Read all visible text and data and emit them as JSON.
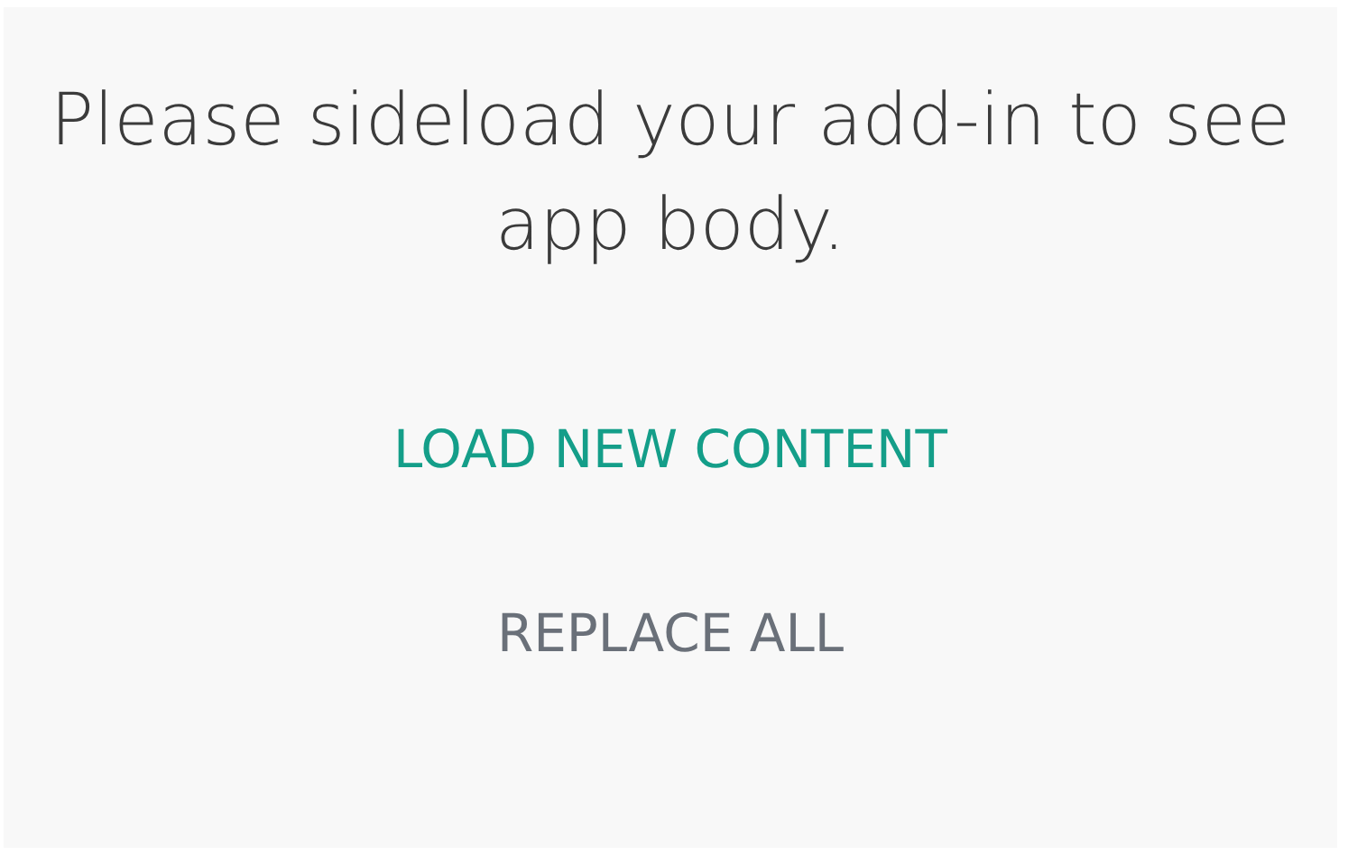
{
  "message": "Please sideload your add-in to see app body.",
  "buttons": [
    {
      "label": "LOAD NEW CONTENT",
      "kind": "primary"
    },
    {
      "label": "REPLACE ALL",
      "kind": "secondary"
    }
  ]
}
